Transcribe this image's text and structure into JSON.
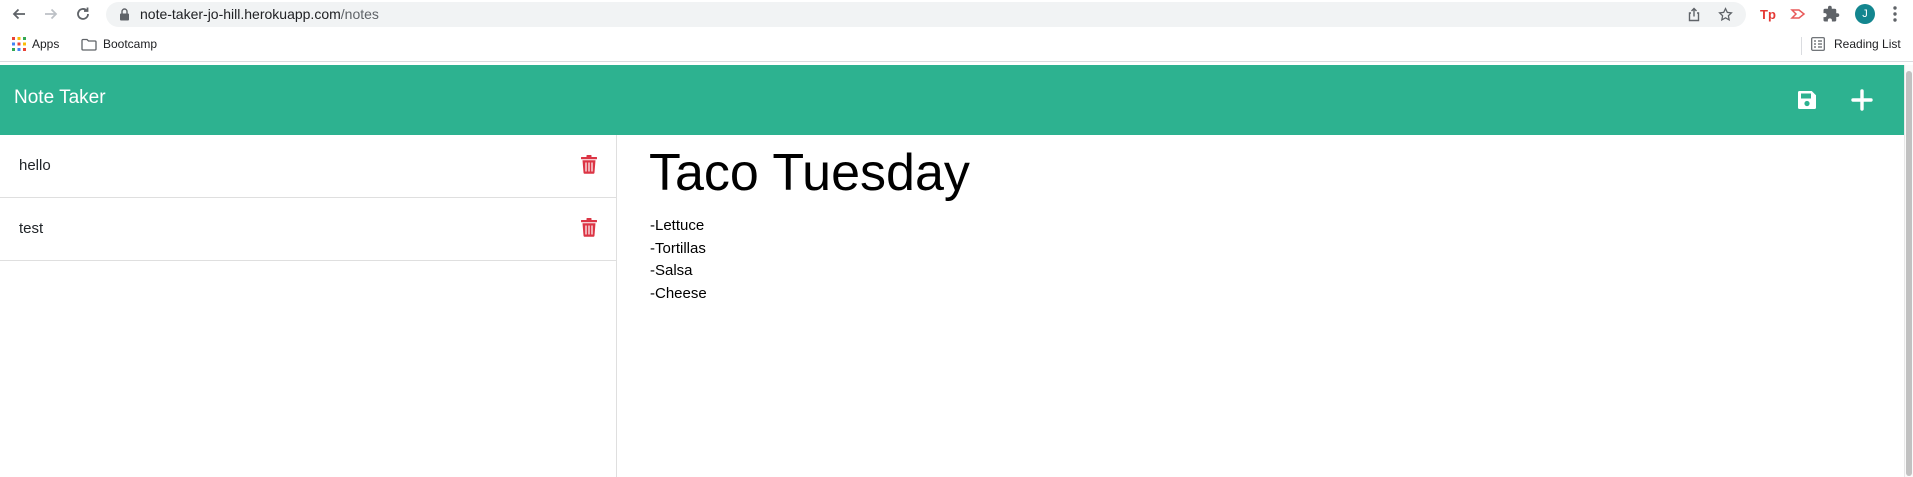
{
  "browser": {
    "url_host": "note-taker-jo-hill.herokuapp.com",
    "url_path": "/notes",
    "avatar_initial": "J",
    "bookmarks": [
      {
        "label": "Apps",
        "icon": "apps-grid-icon"
      },
      {
        "label": "Bootcamp",
        "icon": "folder-icon"
      }
    ],
    "reading_list_label": "Reading List"
  },
  "app": {
    "title": "Note Taker",
    "accent_color": "#2db290",
    "delete_color": "#dc3545"
  },
  "notes": [
    {
      "title": "hello"
    },
    {
      "title": "test"
    }
  ],
  "active_note": {
    "title": "Taco Tuesday",
    "lines": [
      "-Lettuce",
      "-Tortillas",
      "-Salsa",
      "-Cheese"
    ]
  }
}
